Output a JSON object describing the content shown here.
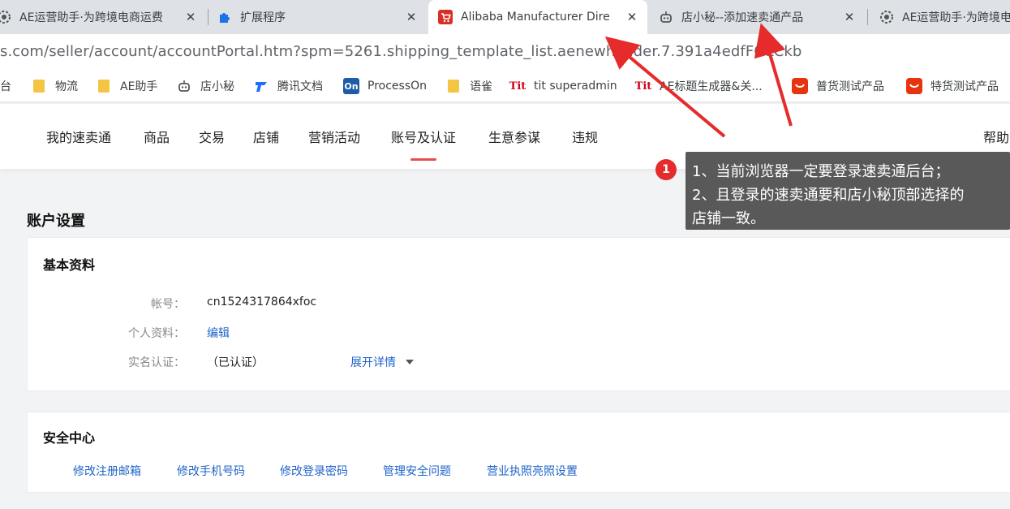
{
  "tabs": [
    {
      "title": "AE运营助手·为跨境电商运费",
      "icon": "gear-face-icon",
      "close": "✕"
    },
    {
      "title": "扩展程序",
      "icon": "puzzle-icon",
      "close": "✕"
    },
    {
      "title": "Alibaba Manufacturer Dire",
      "icon": "shopping-cart-icon",
      "close": "✕"
    },
    {
      "title": "店小秘--添加速卖通产品",
      "icon": "robot-icon",
      "close": "✕"
    },
    {
      "title": "AE运营助手·为跨境电",
      "icon": "gear-face-icon"
    }
  ],
  "address_bar": {
    "url": "s.com/seller/account/accountPortal.htm?spm=5261.shipping_template_list.aenewheader.7.391a4edfFOLCkb"
  },
  "bookmarks": [
    {
      "label": "平台",
      "icon": "folder-icon"
    },
    {
      "label": "物流",
      "icon": "folder-icon"
    },
    {
      "label": "AE助手",
      "icon": "folder-icon"
    },
    {
      "label": "店小秘",
      "icon": "robot-icon"
    },
    {
      "label": "腾讯文档",
      "icon": "tencent-docs-icon"
    },
    {
      "label": "ProcessOn",
      "icon": "processon-icon",
      "icon_text": "On"
    },
    {
      "label": "语雀",
      "icon": "folder-icon"
    },
    {
      "label": "tit superadmin",
      "icon": "tit-icon",
      "icon_text": "Tit"
    },
    {
      "label": "AE标题生成器&关...",
      "icon": "tit-icon",
      "icon_text": "Tit"
    },
    {
      "label": "普货测试产品",
      "icon": "aliexpress-icon"
    },
    {
      "label": "特货测试产品",
      "icon": "aliexpress-icon"
    }
  ],
  "site_nav": {
    "items": [
      "我的速卖通",
      "商品",
      "交易",
      "店铺",
      "营销活动",
      "账号及认证",
      "生意参谋",
      "违规"
    ],
    "active": "账号及认证",
    "help": "帮助"
  },
  "account_settings": {
    "heading": "账户设置",
    "basic_info": {
      "title": "基本资料",
      "account_label": "帐号：",
      "account_value": "cn1524317864xfoc",
      "profile_label": "个人资料：",
      "profile_link": "编辑",
      "verify_label": "实名认证：",
      "verify_value": "（已认证）",
      "expand_link": "展开详情"
    },
    "security_center": {
      "title": "安全中心",
      "links": [
        "修改注册邮箱",
        "修改手机号码",
        "修改登录密码",
        "管理安全问题",
        "营业执照亮照设置"
      ]
    }
  },
  "annotation": {
    "badge": "1",
    "line1": "1、当前浏览器一定要登录速卖通后台；",
    "line2": "2、且登录的速卖通要和店小秘顶部选择的",
    "line3": "店铺一致。"
  },
  "colors": {
    "accent_red": "#e84d4d",
    "link_blue": "#1f64c8",
    "annotation_bg": "#595959",
    "arrow_red": "#e52b2b"
  }
}
